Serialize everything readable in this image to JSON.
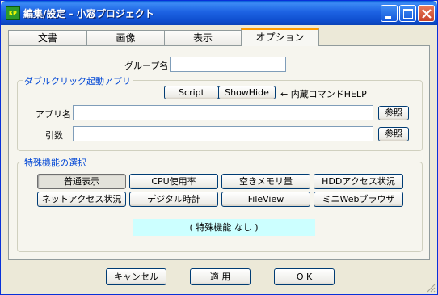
{
  "window": {
    "icon_text": "KP",
    "title": "編集/設定 - 小窓プロジェクト"
  },
  "tabs": [
    "文書",
    "画像",
    "表示",
    "オプション"
  ],
  "group_label": "グループ名",
  "group_value": "",
  "app_group": {
    "legend": "ダブルクリック起動アプリ",
    "script_button": "Script",
    "showhide_button": "ShowHide",
    "help_text": "← 内蔵コマンドHELP",
    "app_label": "アプリ名",
    "app_value": "",
    "args_label": "引数",
    "args_value": "",
    "browse_label": "参照"
  },
  "special_group": {
    "legend": "特殊機能の選択",
    "buttons": [
      "普通表示",
      "CPU使用率",
      "空きメモリ量",
      "HDDアクセス状況",
      "ネットアクセス状況",
      "デジタル時計",
      "FileView",
      "ミニWebブラウザ"
    ],
    "selected": "普通表示",
    "status": "(  特殊機能  なし  )"
  },
  "footer": {
    "cancel": "キャンセル",
    "apply": "適 用",
    "ok": "O K"
  },
  "colors": {
    "titlebar": "#0f4fd0",
    "active_tab_accent": "#ff9c00",
    "legend_text": "#0046d5",
    "status_bg": "#ccffff"
  }
}
